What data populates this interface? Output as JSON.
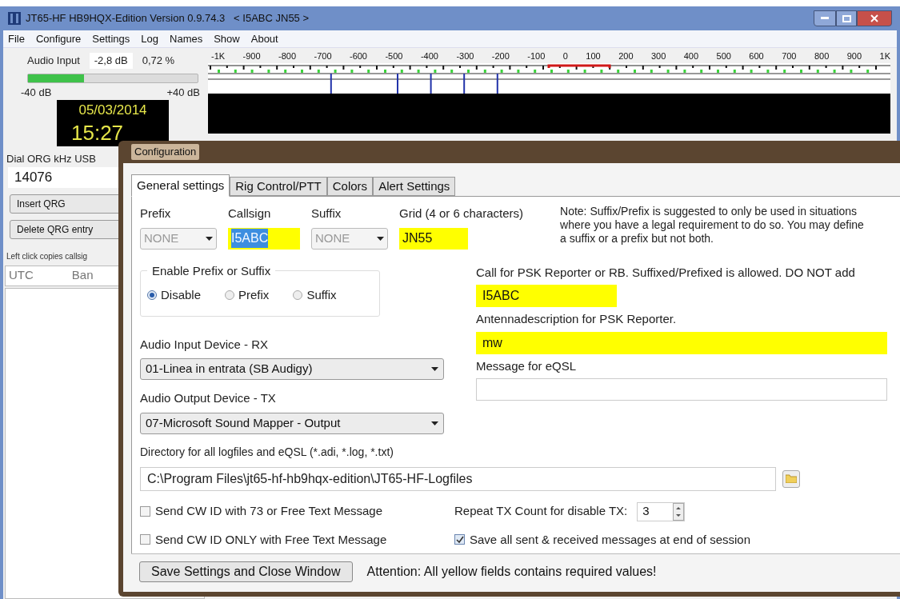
{
  "window": {
    "title": "JT65-HF HB9HQX-Edition Version 0.9.74.3   < I5ABC JN55 >"
  },
  "menu": [
    "File",
    "Configure",
    "Settings",
    "Log",
    "Names",
    "Show",
    "About"
  ],
  "audio_input": {
    "label": "Audio Input",
    "db": "-2,8 dB",
    "percent": "0,72 %",
    "level": 0.33,
    "min": "-40 dB",
    "max": "+40 dB"
  },
  "clock": {
    "date": "05/03/2014",
    "time": "15:27"
  },
  "dial": {
    "label": "Dial ORG kHz USB",
    "value": "14076"
  },
  "qrg_buttons": [
    "Insert QRG",
    "Delete QRG entry"
  ],
  "hint": "Left click copies callsig",
  "list_columns": [
    "UTC",
    "Ban"
  ],
  "spectrum": {
    "scale": [
      "-1K",
      "-900",
      "-800",
      "-700",
      "-600",
      "-500",
      "-400",
      "-300",
      "-200",
      "-100",
      "0",
      "100",
      "200",
      "300",
      "400",
      "500",
      "600",
      "700",
      "800",
      "900",
      "1K"
    ]
  },
  "dialog": {
    "title": "Configuration",
    "tabs": [
      {
        "label": "General settings",
        "selected": true
      },
      {
        "label": "Rig Control/PTT",
        "selected": false
      },
      {
        "label": "Colors",
        "selected": false
      },
      {
        "label": "Alert Settings",
        "selected": false
      }
    ],
    "id_fields": [
      {
        "kind": "select",
        "label": "Prefix",
        "value": "NONE",
        "disabled": true
      },
      {
        "kind": "text",
        "label": "Callsign",
        "value": "I5ABC",
        "required": true,
        "text_selected": true
      },
      {
        "kind": "select",
        "label": "Suffix",
        "value": "NONE",
        "disabled": true
      },
      {
        "kind": "text",
        "label": "Grid (4 or 6 characters)",
        "value": "JN55",
        "required": true,
        "text_selected": false
      }
    ],
    "note": "Note:  Suffix/Prefix is suggested to only be used in situations where you have a legal requirement to do so. You may define a suffix or a prefix but not both.",
    "group": {
      "title": "Enable Prefix or Suffix",
      "options": [
        {
          "label": "Disable",
          "selected": true
        },
        {
          "label": "Prefix",
          "selected": false
        },
        {
          "label": "Suffix",
          "selected": false
        }
      ]
    },
    "audio_input": {
      "label": "Audio Input Device - RX",
      "value": "01-Linea in entrata (SB Audigy)"
    },
    "audio_output": {
      "label": "Audio Output Device - TX",
      "value": "07-Microsoft Sound Mapper - Output"
    },
    "right_fields": [
      {
        "label": "Call for PSK Reporter or RB. Suffixed/Prefixed is allowed. DO NOT add",
        "value": "I5ABC",
        "required": true,
        "short": true
      },
      {
        "label": "Antennadescription for PSK Reporter.",
        "value": "mw",
        "required": true,
        "short": false
      },
      {
        "label": "Message for eQSL",
        "required": false,
        "short": false
      }
    ],
    "directory": {
      "label": "Directory for all logfiles and eQSL (*.adi, *.log, *.txt)",
      "value": "C:\\Program Files\\jt65-hf-hb9hqx-edition\\JT65-HF-Logfiles"
    },
    "checkboxes": [
      {
        "label": "Send CW ID with 73 or Free Text Message",
        "checked": false
      },
      {
        "label": "Send CW ID ONLY with Free Text Message",
        "checked": false
      },
      {
        "label": "Save all sent & received messages at end of session",
        "checked": true
      }
    ],
    "repeat": {
      "label": "Repeat TX Count for disable TX:",
      "value": "3"
    },
    "save_button": "Save Settings and Close Window",
    "attention": "Attention: All yellow fields contains required values!"
  }
}
